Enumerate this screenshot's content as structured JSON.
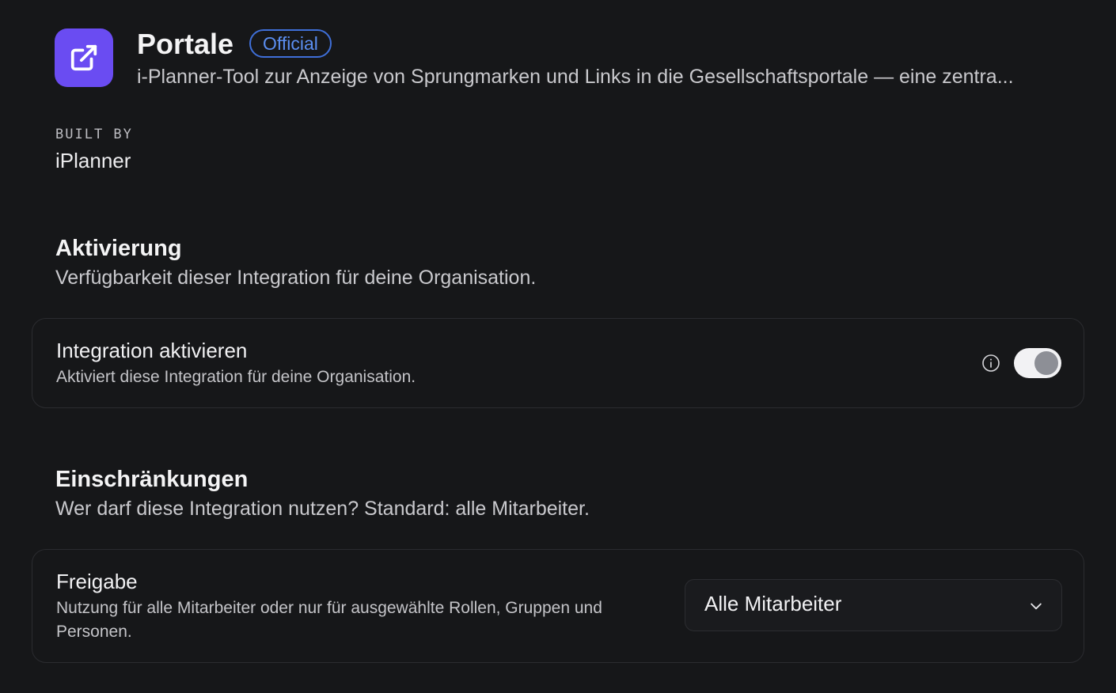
{
  "header": {
    "icon": "external-link-icon",
    "icon_color": "#6a4cf2",
    "title": "Portale",
    "badge": "Official",
    "badge_color": "#5b8ef0",
    "description": "i-Planner-Tool zur Anzeige von Sprungmarken und Links in die Gesellschaftsportale — eine zentra..."
  },
  "built_by": {
    "label": "BUILT BY",
    "value": "iPlanner"
  },
  "activation": {
    "title": "Aktivierung",
    "subtitle": "Verfügbarkeit dieser Integration für deine Organisation.",
    "setting": {
      "label": "Integration aktivieren",
      "description": "Aktiviert diese Integration für deine Organisation.",
      "info_icon": "info-icon",
      "toggle_on": true
    }
  },
  "restrictions": {
    "title": "Einschränkungen",
    "subtitle": "Wer darf diese Integration nutzen? Standard: alle Mitarbeiter.",
    "setting": {
      "label": "Freigabe",
      "description": "Nutzung für alle Mitarbeiter oder nur für ausgewählte Rollen, Gruppen und Personen.",
      "selected": "Alle Mitarbeiter",
      "chevron_icon": "chevron-down-icon"
    }
  }
}
